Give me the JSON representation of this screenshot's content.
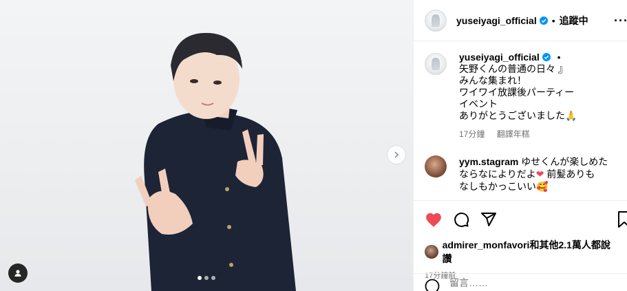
{
  "post": {
    "username": "yuseiyagi_official",
    "follow_status": "追蹤中",
    "separator": "•",
    "more_glyph": "···",
    "caption_lines": [
      "矢野くんの普通の日々 』",
      "みんな集まれ！",
      "ワイワイ放課後パーティー",
      "イベント",
      "ありがとうございました🙏"
    ],
    "caption_time": "17分鐘",
    "translate_label": "翻譯年糕",
    "comment": {
      "username": "yym.stagram",
      "text_lines": [
        "ゆせくんが楽しめた",
        "ならなによりだよ",
        "前髪ありも",
        "なしもかっこいい🥰"
      ],
      "heart": "❤"
    },
    "likes_text": "admirer_monfavori和其他2.1萬人都說讚",
    "post_time": "17分鐘前",
    "comment_placeholder": "留言……"
  },
  "carousel": {
    "total": 3,
    "active": 1
  },
  "colors": {
    "heart": "#ed4956",
    "verified": "#0095f6"
  }
}
